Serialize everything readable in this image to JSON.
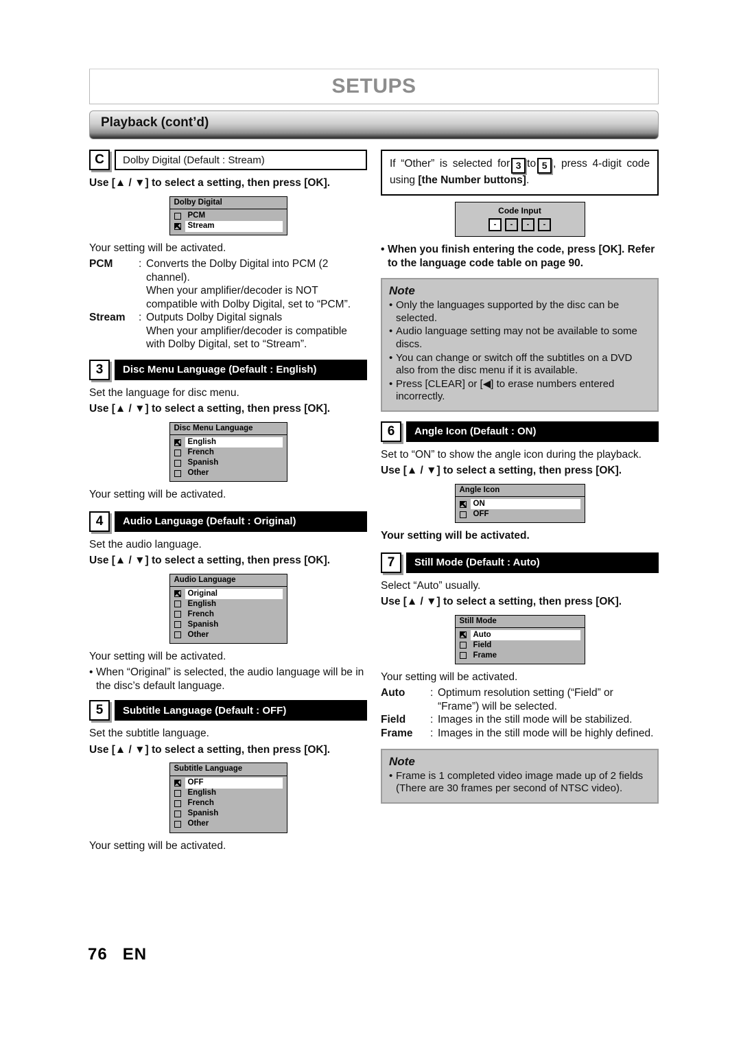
{
  "header": {
    "title": "SETUPS",
    "section": "Playback (cont’d)"
  },
  "footer": {
    "page_number": "76",
    "language_code": "EN"
  },
  "left_column": {
    "dolby_digital": {
      "marker": "C",
      "heading": "Dolby Digital (Default : Stream)",
      "instruction": "Use [▲ / ▼] to select a setting, then press [OK].",
      "osd": {
        "title": "Dolby Digital",
        "options": [
          {
            "label": "PCM",
            "checked": false
          },
          {
            "label": "Stream",
            "checked": true
          }
        ]
      },
      "activated": "Your setting will be activated.",
      "definitions": [
        {
          "term": "PCM",
          "colon": ":",
          "desc": "Converts the Dolby Digital into PCM (2 channel).\nWhen your amplifier/decoder is NOT\ncompatible with Dolby Digital, set to “PCM”."
        },
        {
          "term": "Stream",
          "colon": ":",
          "desc": "Outputs Dolby Digital signals\nWhen your amplifier/decoder is compatible\nwith Dolby Digital, set to “Stream”."
        }
      ]
    },
    "disc_menu_language": {
      "marker": "3",
      "heading": "Disc Menu Language (Default : English)",
      "description": "Set the language for disc menu.",
      "instruction": "Use [▲ / ▼] to select a setting, then press [OK].",
      "osd": {
        "title": "Disc Menu Language",
        "options": [
          {
            "label": "English",
            "checked": true
          },
          {
            "label": "French",
            "checked": false
          },
          {
            "label": "Spanish",
            "checked": false
          },
          {
            "label": "Other",
            "checked": false
          }
        ]
      },
      "activated": "Your setting will be activated."
    },
    "audio_language": {
      "marker": "4",
      "heading": "Audio Language (Default : Original)",
      "description": "Set the audio language.",
      "instruction": "Use [▲ / ▼] to select a setting, then press [OK].",
      "osd": {
        "title": "Audio Language",
        "options": [
          {
            "label": "Original",
            "checked": true
          },
          {
            "label": "English",
            "checked": false
          },
          {
            "label": "French",
            "checked": false
          },
          {
            "label": "Spanish",
            "checked": false
          },
          {
            "label": "Other",
            "checked": false
          }
        ]
      },
      "activated": "Your setting will be activated.",
      "bullets": [
        "When “Original” is selected, the audio language will be in the disc’s default language."
      ]
    },
    "subtitle_language": {
      "marker": "5",
      "heading": "Subtitle Language (Default : OFF)",
      "description": "Set the subtitle language.",
      "instruction": "Use [▲ / ▼] to select a setting, then press [OK].",
      "osd": {
        "title": "Subtitle Language",
        "options": [
          {
            "label": "OFF",
            "checked": true
          },
          {
            "label": "English",
            "checked": false
          },
          {
            "label": "French",
            "checked": false
          },
          {
            "label": "Spanish",
            "checked": false
          },
          {
            "label": "Other",
            "checked": false
          }
        ]
      },
      "activated": "Your setting will be activated."
    }
  },
  "right_column": {
    "other_code_box": {
      "text_part1": "If “Other” is selected for",
      "key1": "3",
      "text_part2": "to",
      "key2": "5",
      "text_part3": ", press 4-digit code using [the Number buttons]."
    },
    "code_input_osd": {
      "title": "Code Input",
      "cells": [
        "-",
        "-",
        "-",
        "-"
      ]
    },
    "code_bullet": "When you finish entering the code, press [OK]. Refer to the language code table on page 90.",
    "note_1": {
      "title": "Note",
      "bullets": [
        "Only the languages supported by the disc can be selected.",
        "Audio language setting may not be available to some discs.",
        "You can change or switch off the subtitles on a DVD also from the disc menu if it is available.",
        "Press [CLEAR] or [◀] to erase numbers entered incorrectly."
      ]
    },
    "angle_icon": {
      "marker": "6",
      "heading": "Angle Icon (Default : ON)",
      "description": "Set to “ON” to show the angle icon during the playback.",
      "instruction": "Use [▲ / ▼] to select a setting, then press [OK].",
      "osd": {
        "title": "Angle Icon",
        "options": [
          {
            "label": "ON",
            "checked": true
          },
          {
            "label": "OFF",
            "checked": false
          }
        ]
      },
      "activated": "Your setting will be activated."
    },
    "still_mode": {
      "marker": "7",
      "heading": "Still Mode (Default : Auto)",
      "description": "Select “Auto” usually.",
      "instruction": "Use [▲ / ▼] to select a setting, then press [OK].",
      "osd": {
        "title": "Still Mode",
        "options": [
          {
            "label": "Auto",
            "checked": true
          },
          {
            "label": "Field",
            "checked": false
          },
          {
            "label": "Frame",
            "checked": false
          }
        ]
      },
      "activated": "Your setting will be activated.",
      "definitions": [
        {
          "term": "Auto",
          "colon": ":",
          "desc": "Optimum resolution setting (“Field” or\n“Frame”) will be selected."
        },
        {
          "term": "Field",
          "colon": ":",
          "desc": "Images in the still mode will be stabilized."
        },
        {
          "term": "Frame",
          "colon": ":",
          "desc": "Images in the still mode will be highly defined."
        }
      ]
    },
    "note_2": {
      "title": "Note",
      "bullets": [
        "Frame is 1 completed video image made up of 2 fields (There are 30 frames per second of NTSC video)."
      ]
    }
  }
}
